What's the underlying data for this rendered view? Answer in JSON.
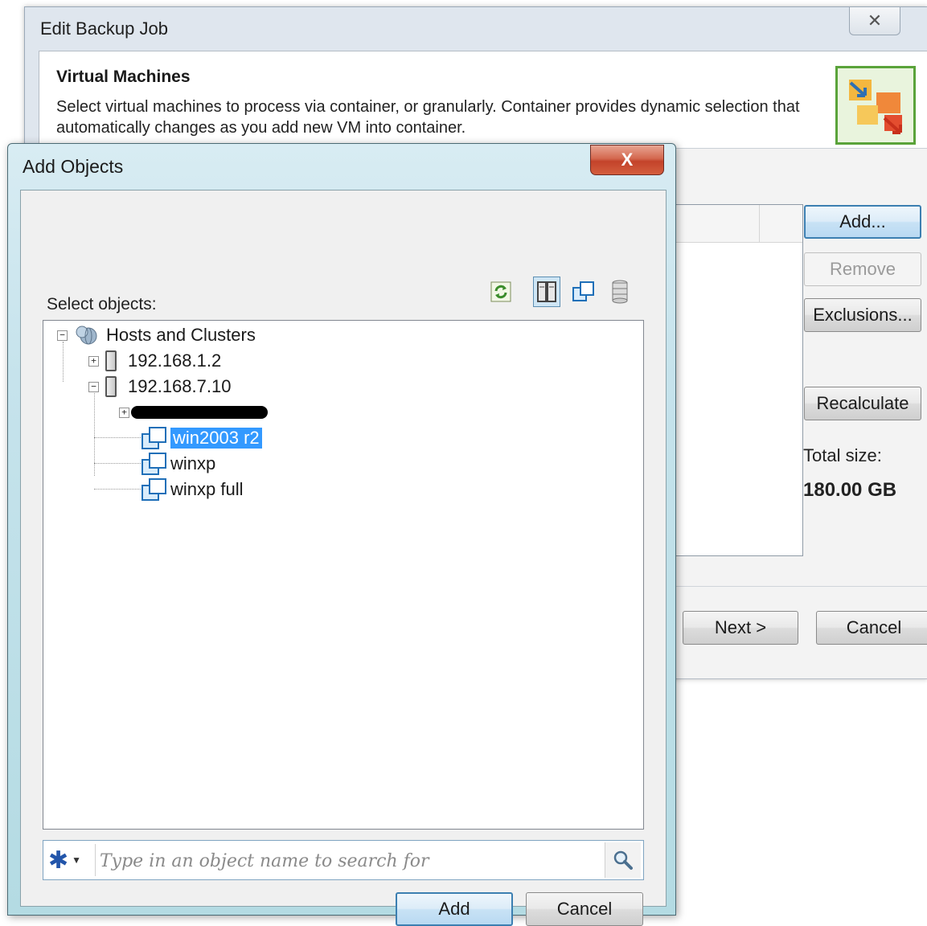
{
  "background_window": {
    "title": "Edit Backup Job",
    "close_glyph": "✕",
    "header": {
      "title": "Virtual Machines",
      "description": "Select virtual machines to process via container, or granularly. Container provides dynamic selection that automatically changes as you add new VM into container."
    },
    "buttons": {
      "add": "Add...",
      "remove": "Remove",
      "exclusions": "Exclusions...",
      "recalculate": "Recalculate",
      "next": "Next >",
      "cancel": "Cancel"
    },
    "total_size_label": "Total size:",
    "total_size_value": "180.00 GB"
  },
  "dialog": {
    "title": "Add Objects",
    "close_glyph": "X",
    "select_label": "Select objects:",
    "toolbar": [
      "refresh-icon",
      "hosts-and-clusters-view-icon",
      "vms-and-templates-view-icon",
      "datastores-view-icon"
    ],
    "tree": {
      "root": "Hosts and Clusters",
      "hosts": [
        {
          "label": "192.168.1.2",
          "expanded": false
        },
        {
          "label": "192.168.7.10",
          "expanded": true
        }
      ],
      "vms": [
        {
          "label": "win2003 r2",
          "selected": true
        },
        {
          "label": "winxp",
          "selected": false
        },
        {
          "label": "winxp full",
          "selected": false
        }
      ]
    },
    "search": {
      "scope_glyph": "✱",
      "placeholder": "Type in an object name to search for"
    },
    "buttons": {
      "add": "Add",
      "cancel": "Cancel"
    },
    "colors": {
      "selection": "#3399ff",
      "frame": "#c6e3ec",
      "close_button": "#c3432a"
    }
  }
}
